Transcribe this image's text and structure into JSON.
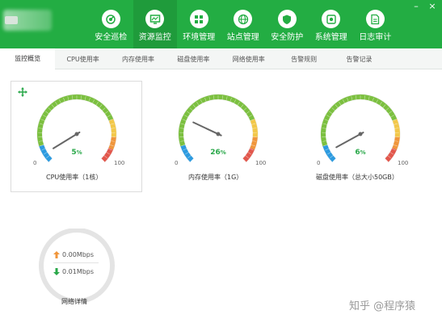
{
  "header": {
    "nav": [
      {
        "label": "安全巡检",
        "icon": "radar-icon"
      },
      {
        "label": "资源监控",
        "icon": "monitor-icon",
        "active": true
      },
      {
        "label": "环境管理",
        "icon": "grid-icon"
      },
      {
        "label": "站点管理",
        "icon": "globe-icon"
      },
      {
        "label": "安全防护",
        "icon": "shield-icon"
      },
      {
        "label": "系统管理",
        "icon": "settings-icon"
      },
      {
        "label": "日志审计",
        "icon": "document-icon"
      }
    ],
    "window_controls": {
      "minimize": "–",
      "close": "×"
    }
  },
  "tabs": [
    "监控概览",
    "CPU使用率",
    "内存使用率",
    "磁盘使用率",
    "网络使用率",
    "告警规则",
    "告警记录"
  ],
  "active_tab": 0,
  "gauges": [
    {
      "caption": "CPU使用率（1核）",
      "value": 5,
      "display": "5",
      "unit": "%",
      "min": "0",
      "max": "100"
    },
    {
      "caption": "内存使用率（1G）",
      "value": 26,
      "display": "26",
      "unit": "%",
      "min": "0",
      "max": "100"
    },
    {
      "caption": "磁盘使用率（总大小50GB）",
      "value": 6,
      "display": "6",
      "unit": "%",
      "min": "0",
      "max": "100"
    }
  ],
  "network": {
    "upload": "0.00Mbps",
    "download": "0.01Mbps",
    "caption": "网络详情"
  },
  "watermark": "知乎 @程序猿",
  "colors": {
    "header_green": "#23ad43",
    "active_nav": "#1f9b3b",
    "gauge_blue": "#2d9be0",
    "gauge_green": "#7cc040",
    "gauge_yellow": "#f2c84a",
    "gauge_orange": "#f0963c",
    "gauge_red": "#e2574c",
    "value_green": "#2aa84a"
  }
}
